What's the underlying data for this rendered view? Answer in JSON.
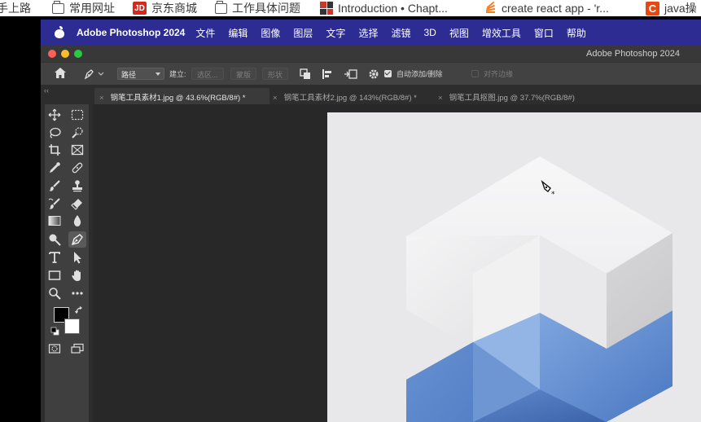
{
  "bookmarks": [
    {
      "label": "手上路",
      "icon": "text-only"
    },
    {
      "label": "常用网址",
      "icon": "folder-icon"
    },
    {
      "label": "京东商城",
      "icon": "jd-logo-icon"
    },
    {
      "label": "工作具体问题",
      "icon": "folder-icon"
    },
    {
      "label": "Introduction • Chapt...",
      "icon": "grid-logo-icon"
    },
    {
      "label": "create react app - 'r...",
      "icon": "stackoverflow-icon"
    },
    {
      "label": "java操",
      "icon": "c-logo-icon"
    }
  ],
  "menubar": {
    "app": "Adobe Photoshop 2024",
    "items": [
      "文件",
      "编辑",
      "图像",
      "图层",
      "文字",
      "选择",
      "滤镜",
      "3D",
      "视图",
      "增效工具",
      "窗口",
      "帮助"
    ]
  },
  "window": {
    "title": "Adobe Photoshop 2024"
  },
  "options": {
    "mode": "路径",
    "make_label": "建立:",
    "selection_btn": "选区...",
    "mask_btn": "蒙版",
    "shape_btn": "形状",
    "auto_add_delete": "自动添加/删除",
    "align_edges": "对齐边缘"
  },
  "tabs": [
    {
      "label": "钢笔工具素材1.jpg @ 43.6%(RGB/8#) *",
      "active": true
    },
    {
      "label": "钢笔工具素材2.jpg @ 143%(RGB/8#) *",
      "active": false
    },
    {
      "label": "钢笔工具抠图.jpg @ 37.7%(RGB/8#)",
      "active": false
    }
  ],
  "tools": [
    "move-icon",
    "marquee-icon",
    "lasso-icon",
    "quick-select-icon",
    "crop-icon",
    "frame-icon",
    "eyedropper-icon",
    "healing-icon",
    "brush-icon",
    "stamp-icon",
    "history-brush-icon",
    "eraser-icon",
    "gradient-icon",
    "blur-icon",
    "dodge-icon",
    "pen-icon",
    "type-icon",
    "path-select-icon",
    "rectangle-icon",
    "hand-icon",
    "zoom-icon",
    "more-icon"
  ],
  "colors": {
    "foreground": "#000000",
    "background": "#ffffff",
    "menubar": "#2c2c93"
  }
}
